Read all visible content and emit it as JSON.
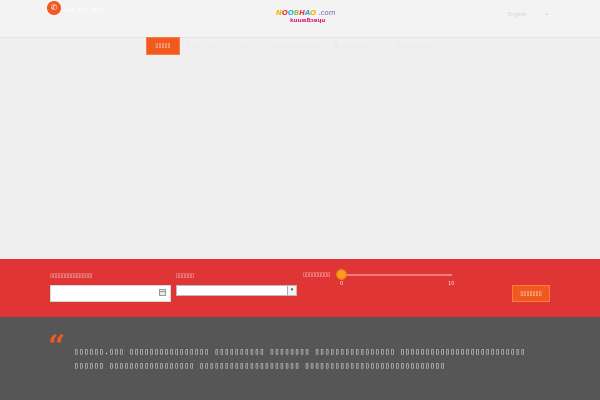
{
  "header": {
    "phone_icon": "phone-icon",
    "phone_number": "+84 123 4567",
    "logo": {
      "top": "NOOBHAO .com",
      "bottom": "kuuʍƃɔɐɥu"
    },
    "language": "English",
    "language_icon": "chevron-down-icon"
  },
  "nav": {
    "items": [
      {
        "label": "▯▯▯▯▯",
        "active": true
      },
      {
        "label": "▯▯▯▯▯▯▯▯▯",
        "icon": "plane-icon"
      },
      {
        "label": "▯▯▯"
      },
      {
        "label": "▯▯▯▯▯▯▯▯▯▯▯▯▯▯▯▯▯▯"
      },
      {
        "label": "▯▯▯▯▯▯▯▯▯▯",
        "icon": "building-icon"
      },
      {
        "label": "▯▯▯▯▯▯▯▯▯▯▯▯",
        "icon": "search-icon"
      }
    ]
  },
  "search": {
    "date_label": "▯▯▯▯▯▯▯▯▯▯▯▯▯▯",
    "date_value": "",
    "date_icon": "calendar-icon",
    "select_label": "▯▯▯▯▯▯",
    "select_value": "",
    "price_label": "▯▯▯▯▯▯▯▯▯",
    "price_min": "0",
    "price_max": "10",
    "slider_value": 0,
    "button_label": "▯▯▯▯▯▯▯"
  },
  "quote": {
    "mark": "“",
    "line1": "▯▯▯▯▯▯.▯▯▯ ▯▯▯▯▯▯▯▯▯▯▯▯▯▯▯▯ ▯▯▯▯▯▯▯▯▯▯ ▯▯▯▯▯▯▯▯ ▯▯▯▯▯▯▯▯▯▯▯▯▯▯▯▯ ▯▯▯▯▯▯▯▯▯▯▯▯▯▯▯▯▯▯▯▯▯▯▯▯▯",
    "line2": "▯▯▯▯▯▯ ▯▯▯▯▯▯▯▯▯▯▯▯▯▯▯▯▯ ▯▯▯▯▯▯▯▯▯▯▯▯▯▯▯▯▯▯▯▯ ▯▯▯▯▯▯▯▯▯▯▯▯▯▯▯▯▯▯▯▯▯▯▯▯▯▯▯▯"
  },
  "colors": {
    "accent": "#f05a1e",
    "search_band": "#df3535",
    "quote_band": "#565656"
  }
}
